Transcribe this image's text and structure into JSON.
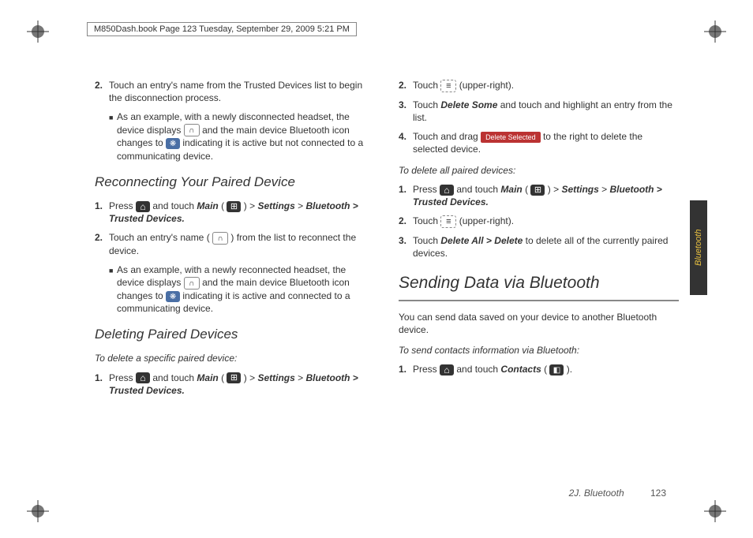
{
  "header": {
    "line": "M850Dash.book  Page 123  Tuesday, September 29, 2009  5:21 PM"
  },
  "left": {
    "step2": {
      "num": "2.",
      "text": "Touch an entry's name from the Trusted Devices list to begin the disconnection process."
    },
    "step2_bullet": "As an example, with a newly disconnected headset, the device displays ",
    "step2_bullet_mid": " and the main device Bluetooth icon changes to ",
    "step2_bullet_end": " indicating it is active but not connected to a communicating device.",
    "h_reconnect": "Reconnecting Your Paired Device",
    "r_step1": {
      "num": "1.",
      "a": "Press ",
      "b": " and touch ",
      "main": "Main",
      "c": " (",
      "d": ") > ",
      "settings": "Settings",
      "gt": " > ",
      "path2": "Bluetooth > Trusted Devices."
    },
    "r_step2": {
      "num": "2.",
      "a": "Touch an entry's name (",
      "b": ") from the list to reconnect the device."
    },
    "r_bullet_a": "As an example, with a newly reconnected headset, the device displays ",
    "r_bullet_mid": " and the main device Bluetooth icon changes to ",
    "r_bullet_end": " indicating it is active and connected to a communicating device.",
    "h_delete": "Deleting Paired Devices",
    "del_label": "To delete a specific paired device:",
    "d_step1": {
      "num": "1.",
      "a": "Press ",
      "b": " and touch ",
      "main": "Main",
      "c": " (",
      "d": ") > ",
      "settings": "Settings",
      "gt": " > ",
      "path2": "Bluetooth > Trusted Devices."
    }
  },
  "right": {
    "step2": {
      "num": "2.",
      "a": "Touch ",
      "b": " (upper-right)."
    },
    "step3": {
      "num": "3.",
      "a": "Touch ",
      "ds": "Delete Some",
      "b": " and touch and highlight an entry from the list."
    },
    "step4": {
      "num": "4.",
      "a": "Touch and drag ",
      "btn": "Delete Selected ",
      "b": " to the right to delete the selected device."
    },
    "all_label": "To delete all paired devices:",
    "a_step1": {
      "num": "1.",
      "a": "Press ",
      "b": " and touch ",
      "main": "Main",
      "c": " (",
      "d": ") > ",
      "settings": "Settings",
      "gt": " > ",
      "path2": "Bluetooth > Trusted Devices."
    },
    "a_step2": {
      "num": "2.",
      "a": "Touch ",
      "b": " (upper-right)."
    },
    "a_step3": {
      "num": "3.",
      "a": "Touch ",
      "da": "Delete All > Delete",
      "b": " to delete all of the currently paired devices."
    },
    "h_sending": "Sending Data via Bluetooth",
    "sending_intro": "You can send data saved on your device to another Bluetooth device.",
    "send_label": "To send contacts information via Bluetooth:",
    "s_step1": {
      "num": "1.",
      "a": "Press ",
      "b": " and touch ",
      "contacts": "Contacts",
      "c": " (",
      "d": ")."
    }
  },
  "sidetab": "Bluetooth",
  "footer": {
    "section": "2J. Bluetooth",
    "page": "123"
  }
}
